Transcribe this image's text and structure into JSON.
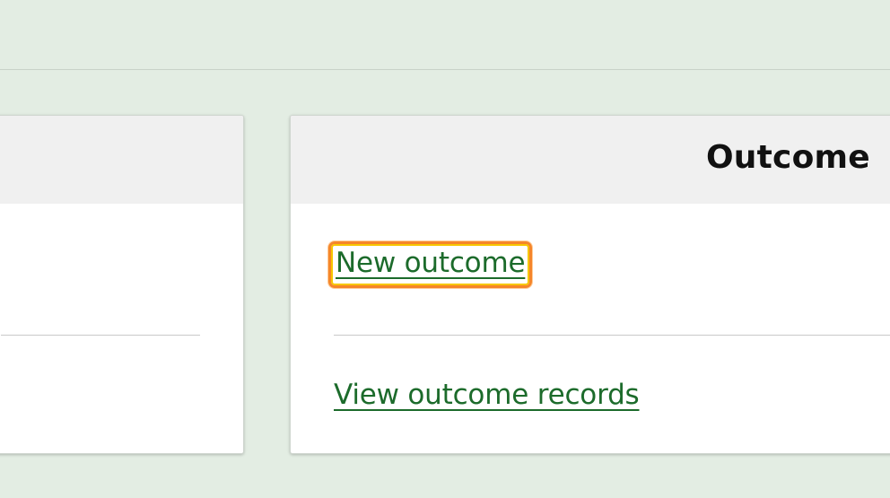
{
  "outcome_card": {
    "title": "Outcome",
    "links": {
      "new_outcome": "New outcome",
      "view_records": "View outcome records"
    }
  },
  "colors": {
    "page_background": "#e3ede3",
    "card_header": "#f0f0f0",
    "link": "#1c6b2b",
    "focus_ring": "#f5862a"
  }
}
